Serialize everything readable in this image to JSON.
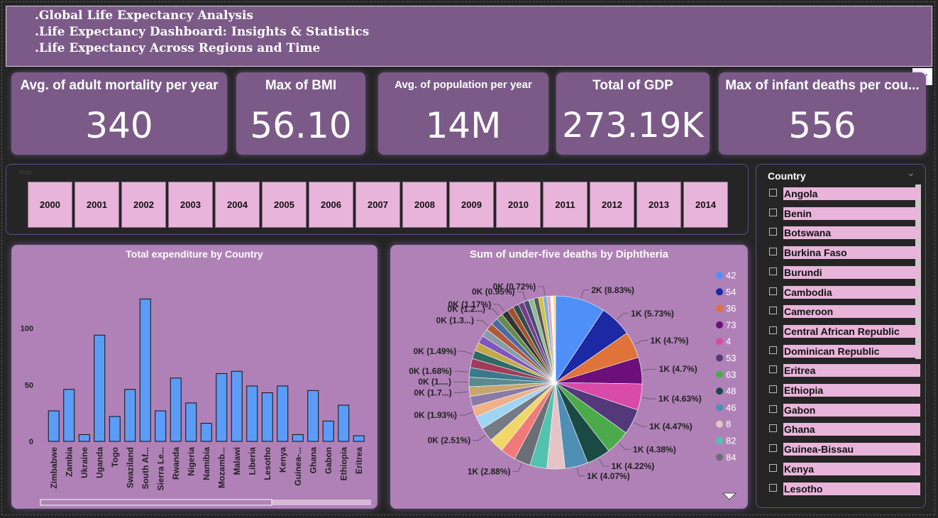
{
  "header": {
    "lines": [
      ".Global Life Expectancy Analysis",
      ".Life Expectancy Dashboard: Insights & Statistics",
      ".Life Expectancy Across Regions and Time"
    ]
  },
  "more_button": "···",
  "kpis": [
    {
      "label": "Avg. of adult mortality per year",
      "value": "340"
    },
    {
      "label": "Max of BMI",
      "value": "56.10"
    },
    {
      "label": "Avg. of population per year",
      "value": "14M"
    },
    {
      "label": "Total of GDP",
      "value": "273.19K"
    },
    {
      "label": "Max of infant deaths per cou...",
      "value": "556"
    }
  ],
  "year_slicer": {
    "title": "Year",
    "years": [
      "2000",
      "2001",
      "2002",
      "2003",
      "2004",
      "2005",
      "2006",
      "2007",
      "2008",
      "2009",
      "2010",
      "2011",
      "2012",
      "2013",
      "2014"
    ]
  },
  "country_slicer": {
    "title": "Country",
    "items": [
      "Angola",
      "Benin",
      "Botswana",
      "Burkina Faso",
      "Burundi",
      "Cambodia",
      "Cameroon",
      "Central African Republic",
      "Dominican Republic",
      "Eritrea",
      "Ethiopia",
      "Gabon",
      "Ghana",
      "Guinea-Bissau",
      "Kenya",
      "Lesotho"
    ]
  },
  "colors": {
    "header_bg": "#7b5a88",
    "card_bg": "#7b5a88",
    "panel_bg": "#b081b7",
    "button_bg": "#e8b4da",
    "bar_color": "#5b9cf6",
    "page_bg": "#252525"
  },
  "chart_data": [
    {
      "type": "bar",
      "title": "Total expenditure by Country",
      "xlabel": "",
      "ylabel": "",
      "categories": [
        "Zimbabwe",
        "Zambia",
        "Ukraine",
        "Uganda",
        "Togo",
        "Swaziland",
        "South Af...",
        "Sierra Le...",
        "Rwanda",
        "Nigeria",
        "Namibia",
        "Mozamb...",
        "Malawi",
        "Liberia",
        "Lesotho",
        "Kenya",
        "Guinea-...",
        "Ghana",
        "Gabon",
        "Ethiopia",
        "Eritrea"
      ],
      "values": [
        27,
        46,
        6,
        94,
        22,
        46,
        126,
        27,
        56,
        34,
        16,
        60,
        62,
        49,
        43,
        49,
        6,
        45,
        18,
        32,
        5
      ],
      "yticks": [
        0,
        50,
        100
      ],
      "ylim": [
        0,
        135
      ],
      "grid": false
    },
    {
      "type": "pie",
      "title": "Sum of under-five deaths by Diphtheria",
      "legend": {
        "position": "right",
        "items": [
          {
            "label": "42",
            "color": "#4f8ff8"
          },
          {
            "label": "54",
            "color": "#1c29a2"
          },
          {
            "label": "36",
            "color": "#e0733a"
          },
          {
            "label": "73",
            "color": "#6d0f7a"
          },
          {
            "label": "4",
            "color": "#d94aa9"
          },
          {
            "label": "53",
            "color": "#53397a"
          },
          {
            "label": "63",
            "color": "#4bab4b"
          },
          {
            "label": "48",
            "color": "#1b4a45"
          },
          {
            "label": "46",
            "color": "#4f8fb5"
          },
          {
            "label": "8",
            "color": "#e5c4c8"
          },
          {
            "label": "82",
            "color": "#53c2b0"
          },
          {
            "label": "84",
            "color": "#6b6e74"
          }
        ]
      },
      "slices": [
        {
          "value": 8.83,
          "color": "#4f8ff8",
          "label": "2K (8.83%)"
        },
        {
          "value": 5.73,
          "color": "#1c29a2",
          "label": "1K (5.73%)"
        },
        {
          "value": 4.7,
          "color": "#e0733a",
          "label": "1K (4.7%)"
        },
        {
          "value": 4.7,
          "color": "#6d0f7a",
          "label": "1K (4.7%)"
        },
        {
          "value": 4.63,
          "color": "#d94aa9",
          "label": "1K (4.63%)"
        },
        {
          "value": 4.47,
          "color": "#53397a",
          "label": "1K (4.47%)"
        },
        {
          "value": 4.38,
          "color": "#4bab4b",
          "label": "1K (4.38%)"
        },
        {
          "value": 4.22,
          "color": "#1b4a45",
          "label": "1K (4.22%)"
        },
        {
          "value": 4.07,
          "color": "#4f8fb5",
          "label": "1K (4.07%)"
        },
        {
          "value": 3.2,
          "color": "#e5c4c8",
          "label": ""
        },
        {
          "value": 3.0,
          "color": "#53c2b0",
          "label": ""
        },
        {
          "value": 2.88,
          "color": "#6b6e74",
          "label": "1K (2.88%)"
        },
        {
          "value": 2.7,
          "color": "#f07a7a",
          "label": ""
        },
        {
          "value": 2.6,
          "color": "#f1d668",
          "label": ""
        },
        {
          "value": 2.51,
          "color": "#757a84",
          "label": "0K (2.51%)"
        },
        {
          "value": 2.3,
          "color": "#9fd4f2",
          "label": ""
        },
        {
          "value": 1.93,
          "color": "#f0b08a",
          "label": "0K (1.93%)"
        },
        {
          "value": 1.8,
          "color": "#8a7aa6",
          "label": ""
        },
        {
          "value": 1.7,
          "color": "#c6a66e",
          "label": "0K (1.7...)"
        },
        {
          "value": 1.68,
          "color": "#5a8a8f",
          "label": "0K (1....)"
        },
        {
          "value": 1.68,
          "color": "#3a7a8a",
          "label": "0K (1.68%)"
        },
        {
          "value": 1.6,
          "color": "#a33a5a",
          "label": ""
        },
        {
          "value": 1.49,
          "color": "#2e6a66",
          "label": "0K (1.49%)"
        },
        {
          "value": 1.45,
          "color": "#c4a94a",
          "label": ""
        },
        {
          "value": 1.4,
          "color": "#7e57c2",
          "label": ""
        },
        {
          "value": 1.35,
          "color": "#8a9aa6",
          "label": ""
        },
        {
          "value": 1.3,
          "color": "#b05a3a",
          "label": "0K (1.3...)"
        },
        {
          "value": 1.25,
          "color": "#4a6aa6",
          "label": ""
        },
        {
          "value": 1.2,
          "color": "#6a8a4a",
          "label": "0K (1.2...)"
        },
        {
          "value": 1.17,
          "color": "#333333",
          "label": "0K (1.17%)"
        },
        {
          "value": 1.1,
          "color": "#a0522d",
          "label": ""
        },
        {
          "value": 1.05,
          "color": "#2f4f4f",
          "label": ""
        },
        {
          "value": 1.0,
          "color": "#7a3a8a",
          "label": ""
        },
        {
          "value": 0.95,
          "color": "#4a4a7a",
          "label": "0K (0.95%)"
        },
        {
          "value": 0.9,
          "color": "#8fbc8f",
          "label": ""
        },
        {
          "value": 0.85,
          "color": "#5a5a5a",
          "label": ""
        },
        {
          "value": 0.8,
          "color": "#d8c040",
          "label": ""
        },
        {
          "value": 0.72,
          "color": "#7ab0d8",
          "label": "0K (0.72%)"
        },
        {
          "value": 0.6,
          "color": "#e8a0c0",
          "label": ""
        },
        {
          "value": 0.5,
          "color": "#ffffff",
          "label": ""
        },
        {
          "value": 0.4,
          "color": "#ffd27a",
          "label": ""
        }
      ]
    }
  ]
}
